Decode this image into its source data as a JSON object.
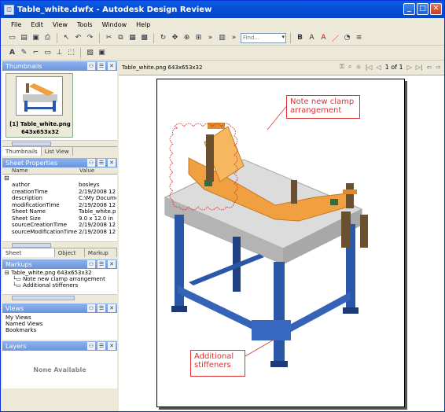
{
  "window": {
    "title": "Table_white.dwfx - Autodesk Design Review"
  },
  "menu": [
    "File",
    "Edit",
    "View",
    "Tools",
    "Window",
    "Help"
  ],
  "toolbar": {
    "find_placeholder": "Find..."
  },
  "thumbnails": {
    "header": "Thumbnails",
    "items": [
      {
        "label": "[1] Table_white.png",
        "sub": "643x653x32"
      }
    ],
    "tabs": [
      "Thumbnails",
      "List View"
    ]
  },
  "sheet_properties": {
    "header": "Sheet Properties",
    "col_name": "Name",
    "col_value": "Value",
    "rows": [
      [
        "author",
        "bosleys"
      ],
      [
        "creationTime",
        "2/19/2008  12"
      ],
      [
        "description",
        "C:\\My Docume"
      ],
      [
        "modificationTime",
        "2/19/2008  12"
      ],
      [
        "Sheet Name",
        "Table_white.pr"
      ],
      [
        "Sheet Size",
        "9.0 x 12.0 in"
      ],
      [
        "sourceCreationTime",
        "2/19/2008  12"
      ],
      [
        "sourceModificationTime",
        "2/19/2008  12"
      ]
    ],
    "tabs": [
      "Sheet Properties",
      "Object P",
      "Markup F"
    ]
  },
  "markups": {
    "header": "Markups",
    "root": "Table_white.png 643x653x32",
    "items": [
      "Note new clamp arrangement",
      "Additional stiffeners"
    ]
  },
  "views": {
    "header": "Views",
    "items": [
      "My Views",
      "Named Views",
      "Bookmarks"
    ]
  },
  "layers": {
    "header": "Layers",
    "empty": "None Available"
  },
  "canvas": {
    "sheet_label": "Table_white.png 643x653x32",
    "page_indicator": "1 of 1",
    "note1_line1": "Note new clamp",
    "note1_line2": "arrangement",
    "note2_line1": "Additional",
    "note2_line2": "stiffeners"
  }
}
